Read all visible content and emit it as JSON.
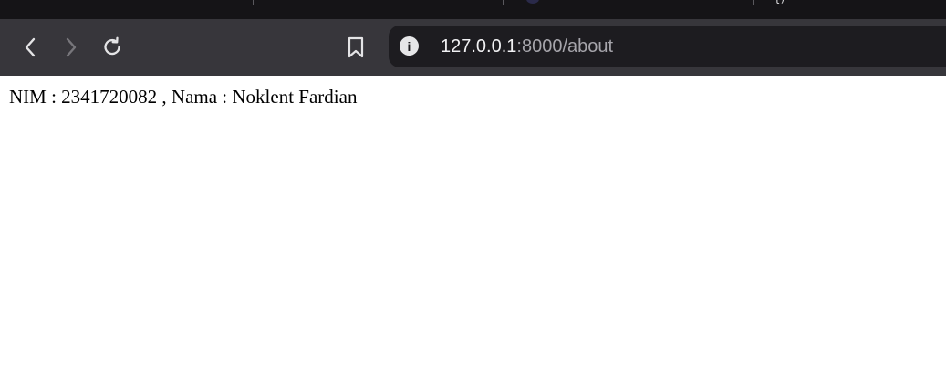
{
  "browser": {
    "tabstrip": {
      "partial_glyph": "{)"
    },
    "toolbar": {
      "back_icon": "chevron-left-icon",
      "forward_icon": "chevron-right-icon",
      "reload_icon": "reload-icon",
      "bookmark_icon": "bookmark-icon"
    },
    "address_bar": {
      "host": "127.0.0.1",
      "path": ":8000/about",
      "site_info_icon": "info-icon",
      "site_info_glyph": "i"
    }
  },
  "page": {
    "text": "NIM : 2341720082 , Nama : Noklent Fardian"
  },
  "colors": {
    "tabstrip_bg": "#151417",
    "toolbar_bg": "#37363b",
    "omnibox_bg": "#1d1c20",
    "url_host": "#f1f1f3",
    "url_path": "#a6a5ab",
    "page_bg": "#ffffff"
  }
}
